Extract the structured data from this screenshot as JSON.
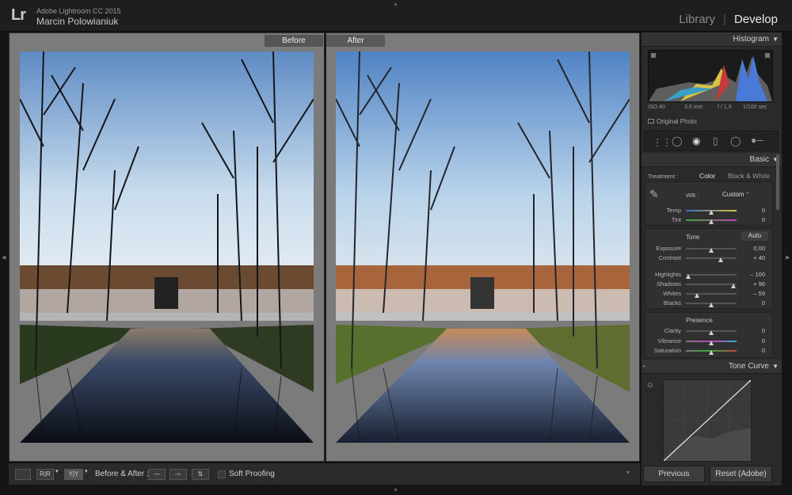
{
  "app": {
    "logo": "Lr",
    "name": "Adobe Lightroom CC 2015",
    "user": "Marcin Polowianiuk"
  },
  "modules": {
    "library": "Library",
    "sep": "|",
    "develop": "Develop"
  },
  "compare": {
    "before": "Before",
    "after": "After"
  },
  "toolbar": {
    "view_a": "",
    "view_b": "R|R",
    "view_c": "Y|Y",
    "before_after": "Before & After :",
    "soft_proofing": "Soft Proofing"
  },
  "histogram": {
    "title": "Histogram",
    "iso": "ISO 40",
    "focal": "3.6 mm",
    "aperture": "f / 1,9",
    "shutter": "1/100 sec",
    "original": "Original Photo"
  },
  "basic": {
    "title": "Basic",
    "treatment_label": "Treatment :",
    "color": "Color",
    "bw": "Black & White",
    "wb_label": "WB :",
    "wb_value": "Custom",
    "temp": {
      "label": "Temp",
      "value": "0"
    },
    "tint": {
      "label": "Tint",
      "value": "0"
    },
    "tone_label": "Tone",
    "auto": "Auto",
    "exposure": {
      "label": "Exposure",
      "value": "0,00"
    },
    "contrast": {
      "label": "Contrast",
      "value": "+ 40"
    },
    "highlights": {
      "label": "Highlights",
      "value": "– 100"
    },
    "shadows": {
      "label": "Shadows",
      "value": "+ 96"
    },
    "whites": {
      "label": "Whites",
      "value": "– 59"
    },
    "blacks": {
      "label": "Blacks",
      "value": "0"
    },
    "presence_label": "Presence",
    "clarity": {
      "label": "Clarity",
      "value": "0"
    },
    "vibrance": {
      "label": "Vibrance",
      "value": "0"
    },
    "saturation": {
      "label": "Saturation",
      "value": "0"
    }
  },
  "tone_curve": {
    "title": "Tone Curve"
  },
  "buttons": {
    "previous": "Previous",
    "reset": "Reset (Adobe)"
  }
}
